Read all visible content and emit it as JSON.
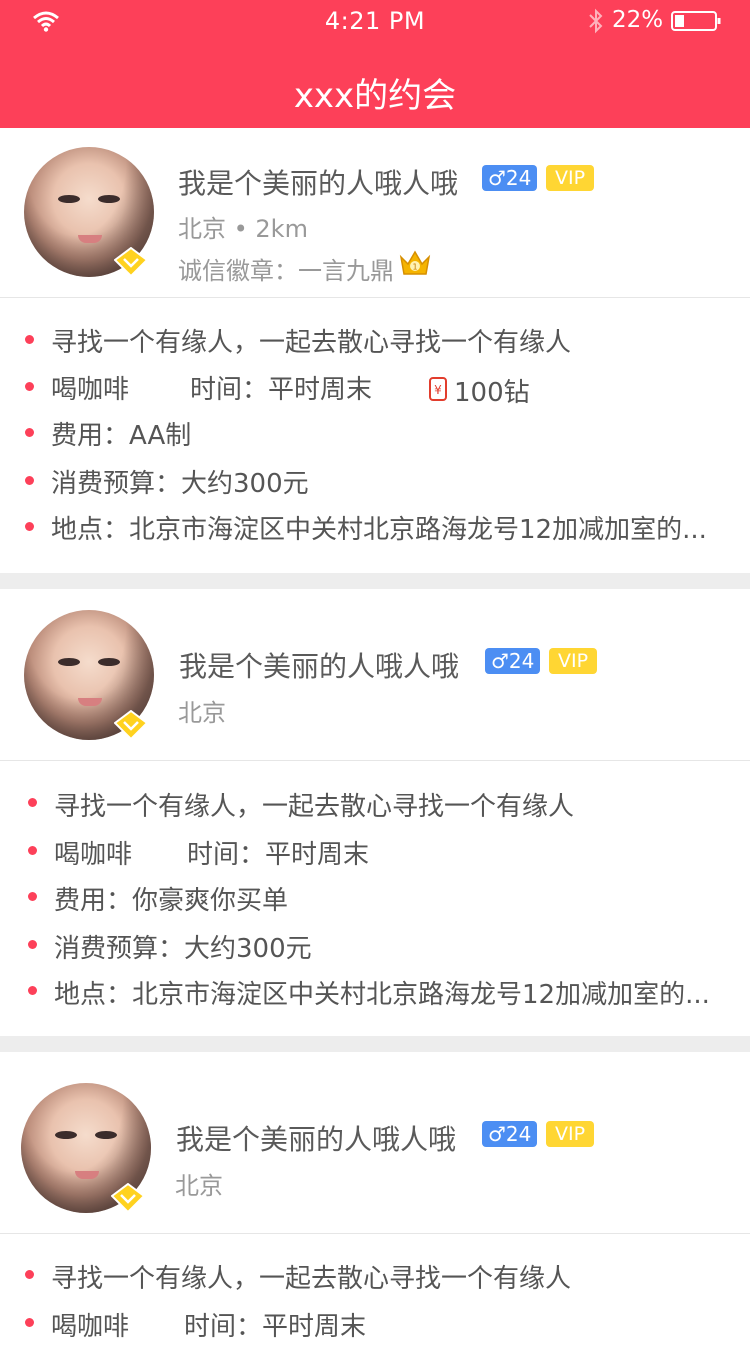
{
  "status_bar": {
    "time": "4:21 PM",
    "battery": "22%"
  },
  "nav": {
    "title": "xxx的约会"
  },
  "cards": [
    {
      "name": "我是个美丽的人哦人哦",
      "gender_age": "♂24",
      "vip": "VIP",
      "location": "北京 • 2km",
      "honor": "诚信徽章：一言九鼎",
      "topic": "寻找一个有缘人，一起去散心寻找一个有缘人",
      "activity": "喝咖啡",
      "time": "时间：平时周末",
      "diamond": "100钻",
      "fee": "费用：AA制",
      "budget": "消费预算：大约300元",
      "place": "地点：北京市海淀区中关村北京路海龙号12加减加室的..."
    },
    {
      "name": "我是个美丽的人哦人哦",
      "gender_age": "♂24",
      "vip": "VIP",
      "location": "北京",
      "topic": "寻找一个有缘人，一起去散心寻找一个有缘人",
      "activity": "喝咖啡",
      "time": "时间：平时周末",
      "fee": "费用：你豪爽你买单",
      "budget": "消费预算：大约300元",
      "place": "地点：北京市海淀区中关村北京路海龙号12加减加室的..."
    },
    {
      "name": "我是个美丽的人哦人哦",
      "gender_age": "♂24",
      "vip": "VIP",
      "location": "北京",
      "topic": "寻找一个有缘人，一起去散心寻找一个有缘人",
      "activity": "喝咖啡",
      "time": "时间：平时周末"
    }
  ],
  "colors": {
    "accent": "#fd4059",
    "gender": "#4c8ef3",
    "vip": "#ffd633"
  },
  "icons": [
    "wifi-icon",
    "bluetooth-icon",
    "battery-icon",
    "vip-diamond-badge-icon",
    "crown-icon",
    "red-packet-icon"
  ]
}
